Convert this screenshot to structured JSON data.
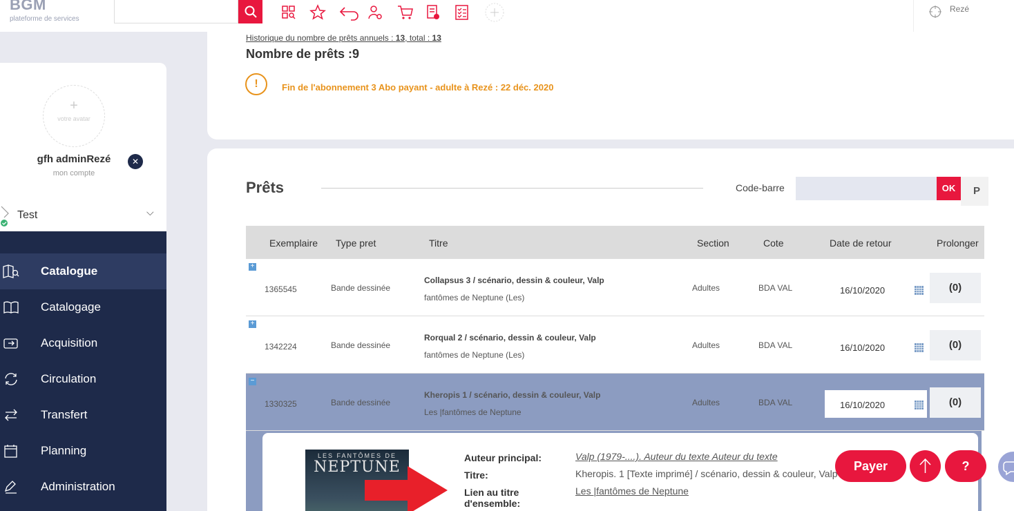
{
  "header": {
    "logo": "BGM",
    "logo_sub": "plateforme de services",
    "location": "Rezé"
  },
  "colors": {
    "accent": "#e8173e",
    "navy": "#1e2a4a",
    "warning": "#e8931c"
  },
  "sidebar": {
    "avatar_text": "votre avatar",
    "avatar_plus": "+",
    "user_name": "gfh adminRezé",
    "user_sub": "mon compte",
    "workspace": "Test",
    "nav": [
      {
        "label": "Catalogue",
        "icon": "catalogue-search-icon",
        "active": true
      },
      {
        "label": "Catalogage",
        "icon": "book-open-icon",
        "active": false
      },
      {
        "label": "Acquisition",
        "icon": "acquisition-icon",
        "active": false
      },
      {
        "label": "Circulation",
        "icon": "refresh-icon",
        "active": false
      },
      {
        "label": "Transfert",
        "icon": "transfer-arrows-icon",
        "active": false
      },
      {
        "label": "Planning",
        "icon": "calendar-icon",
        "active": false
      },
      {
        "label": "Administration",
        "icon": "pen-icon",
        "active": false
      }
    ]
  },
  "summary": {
    "history_prefix": "Historique du nombre de prêts annuels : ",
    "history_annual": "13",
    "history_mid": ", total : ",
    "history_total": "13",
    "nb_prets": "Nombre de prêts :9",
    "warning_icon": "!",
    "warning": "Fin de l'abonnement 3 Abo payant - adulte à Rezé : 22 déc. 2020"
  },
  "loans": {
    "title": "Prêts",
    "barcode_label": "Code-barre",
    "barcode_value": "",
    "ok_label": "OK",
    "p_label": "P",
    "columns": [
      "Exemplaire",
      "Type pret",
      "Titre",
      "Section",
      "Cote",
      "Date de retour",
      "Prolonger"
    ],
    "rows": [
      {
        "expand": "+",
        "exemplaire": "1365545",
        "type": "Bande dessinée",
        "title": "Collapsus 3 / scénario, dessin & couleur, Valp",
        "series": "fantômes de Neptune (Les)",
        "section": "Adultes",
        "cote": "BDA VAL",
        "date": "16/10/2020",
        "prolong": "(0)"
      },
      {
        "expand": "+",
        "exemplaire": "1342224",
        "type": "Bande dessinée",
        "title": "Rorqual 2 / scénario, dessin & couleur, Valp",
        "series": "fantômes de Neptune (Les)",
        "section": "Adultes",
        "cote": "BDA VAL",
        "date": "16/10/2020",
        "prolong": "(0)"
      },
      {
        "expand": "−",
        "exemplaire": "1330325",
        "type": "Bande dessinée",
        "title": "Kheropis 1 / scénario, dessin & couleur, Valp",
        "series": "Les |fantômes de Neptune",
        "section": "Adultes",
        "cote": "BDA VAL",
        "date": "16/10/2020",
        "prolong": "(0)"
      }
    ]
  },
  "detail": {
    "cover_line1": "LES FANTÔMES DE",
    "cover_line2": "NEPTUNE",
    "author_label": "Auteur principal:",
    "author_value": "Valp (1979-....). Auteur du texte Auteur du texte",
    "title_label": "Titre:",
    "title_value": "Kheropis. 1 [Texte imprimé] / scénario, dessin & couleur, Valp",
    "link_label_1": "Lien au titre",
    "link_label_2": "d'ensemble:",
    "link_value": "Les |fantômes de Neptune"
  },
  "fab": {
    "pay": "Payer",
    "help": "?"
  }
}
